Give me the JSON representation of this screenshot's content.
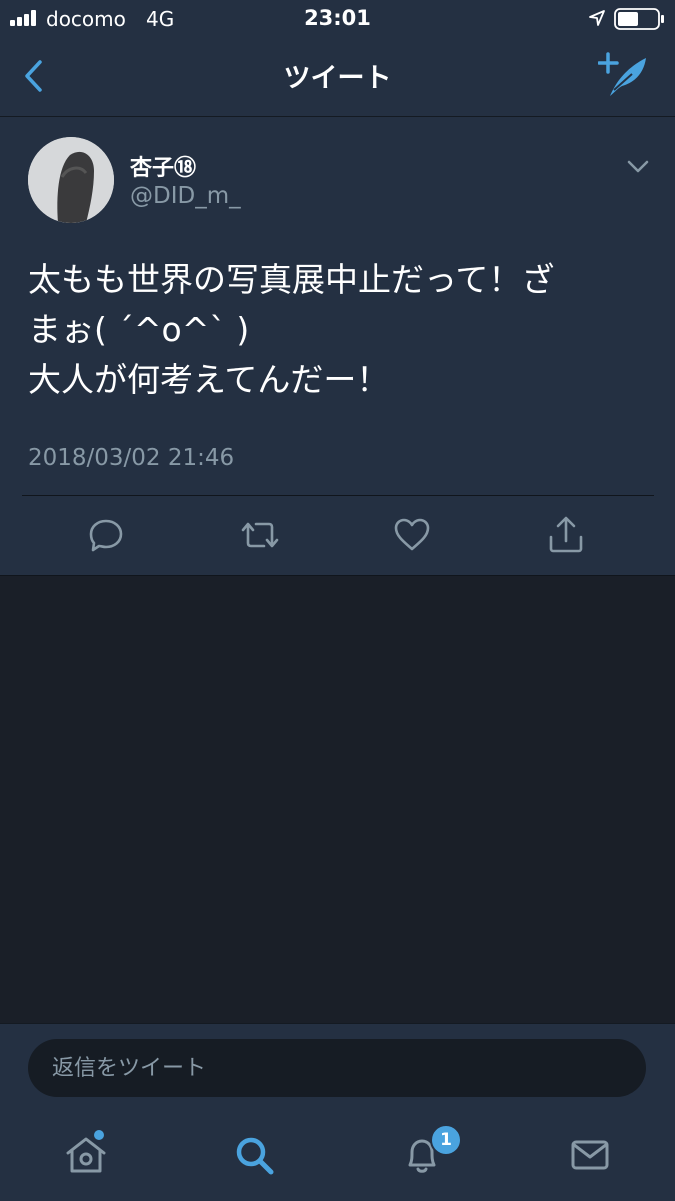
{
  "status_bar": {
    "carrier": "docomo",
    "network": "4G",
    "time": "23:01"
  },
  "nav": {
    "title": "ツイート",
    "back_icon": "chevron-left-icon",
    "compose_icon": "compose-feather-icon"
  },
  "tweet": {
    "display_name": "杏子⑱",
    "handle": "@DID_m_",
    "text_lines": [
      "太もも世界の写真展中止だって！ざ",
      "まぉ( ´^o^` )",
      "大人が何考えてんだー！"
    ],
    "timestamp": "2018/03/02 21:46"
  },
  "actions": [
    "reply-icon",
    "retweet-icon",
    "like-icon",
    "share-icon"
  ],
  "reply": {
    "placeholder": "返信をツイート"
  },
  "tabbar": {
    "tabs": [
      "home-icon",
      "search-icon",
      "notifications-icon",
      "messages-icon"
    ],
    "notification_count": "1"
  },
  "colors": {
    "bar_bg": "#243042",
    "body_bg": "#1a1f28",
    "accent": "#4aa3df",
    "secondary_text": "#8899a6"
  }
}
